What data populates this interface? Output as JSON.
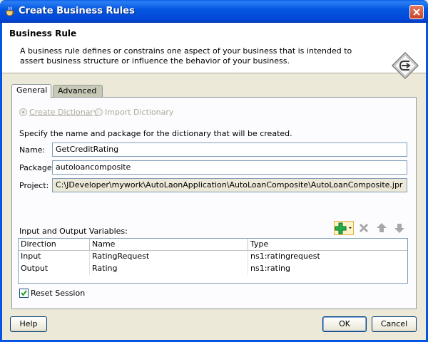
{
  "window": {
    "title": "Create Business Rules"
  },
  "header": {
    "title": "Business Rule",
    "description": "A business rule defines or constrains one aspect of your business that is intended to assert business structure or influence the behavior of your business."
  },
  "tabs": [
    {
      "label": "General",
      "active": true
    },
    {
      "label": "Advanced",
      "active": false
    }
  ],
  "radios": [
    {
      "label": "Create Dictionary",
      "selected": true,
      "enabled": false
    },
    {
      "label": "Import Dictionary",
      "selected": false,
      "enabled": false
    }
  ],
  "instructions": "Specify the name and package for the dictionary that will be created.",
  "form": {
    "name_label": "Name:",
    "name_value": "GetCreditRating",
    "package_label": "Package:",
    "package_value": "autoloancomposite",
    "project_label": "Project:",
    "project_value": "C:\\JDeveloper\\mywork\\AutoLaonApplication\\AutoLoanComposite\\AutoLoanComposite.jpr"
  },
  "variables": {
    "label": "Input and Output Variables:",
    "columns": [
      "Direction",
      "Name",
      "Type"
    ],
    "rows": [
      [
        "Input",
        "RatingRequest",
        "ns1:ratingrequest"
      ],
      [
        "Output",
        "Rating",
        "ns1:rating"
      ]
    ],
    "toolbar_icons": [
      "add-icon",
      "delete-icon",
      "move-up-icon",
      "move-down-icon"
    ]
  },
  "reset_session": {
    "label": "Reset Session",
    "checked": true
  },
  "buttons": {
    "help": "Help",
    "ok": "OK",
    "cancel": "Cancel"
  },
  "colors": {
    "titlebar": "#0246d8",
    "add_icon": "#22b14c",
    "dialog_bg": "#ece9d8"
  }
}
